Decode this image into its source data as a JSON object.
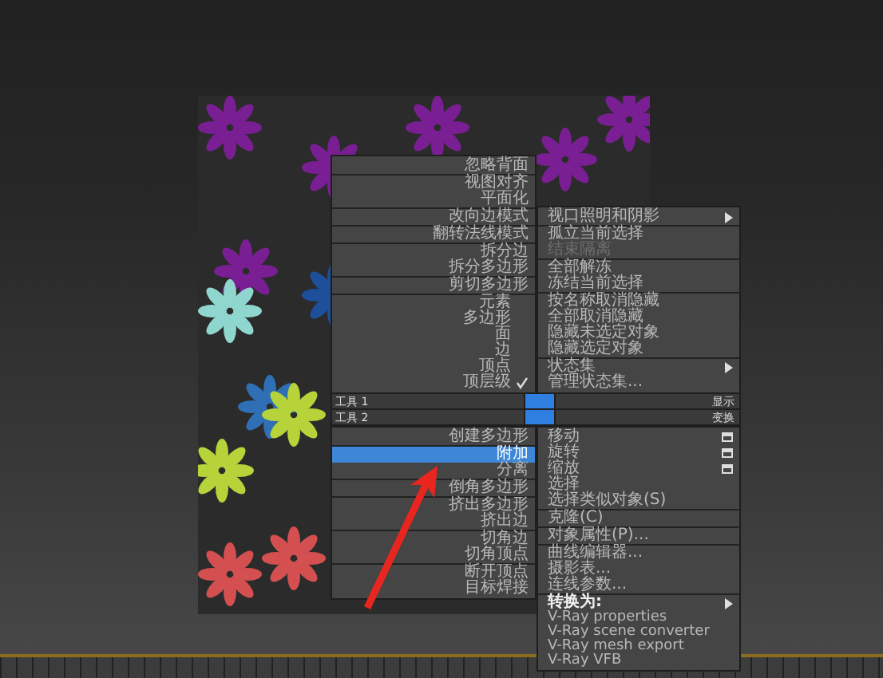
{
  "quad_menu": {
    "top_left": {
      "groups": [
        {
          "items": [
            {
              "label": "忽略背面"
            }
          ]
        },
        {
          "items": [
            {
              "label": "视图对齐"
            },
            {
              "label": "平面化"
            }
          ]
        },
        {
          "items": [
            {
              "label": "改向边模式"
            }
          ]
        },
        {
          "items": [
            {
              "label": "翻转法线模式"
            }
          ]
        },
        {
          "items": [
            {
              "label": "拆分边"
            },
            {
              "label": "拆分多边形"
            }
          ]
        },
        {
          "items": [
            {
              "label": "剪切多边形"
            }
          ]
        },
        {
          "items": [
            {
              "label": "元素",
              "checked": false
            },
            {
              "label": "多边形",
              "checked": false
            },
            {
              "label": "面",
              "checked": false
            },
            {
              "label": "边",
              "checked": false
            },
            {
              "label": "顶点",
              "checked": false
            },
            {
              "label": "顶层级",
              "checked": true
            }
          ]
        }
      ]
    },
    "top_right": {
      "groups": [
        {
          "items": [
            {
              "label": "视口照明和阴影",
              "submenu": true
            }
          ]
        },
        {
          "items": [
            {
              "label": "孤立当前选择",
              "disabled": false
            },
            {
              "label": "结束隔离",
              "disabled": true
            }
          ]
        },
        {
          "items": [
            {
              "label": "全部解冻"
            },
            {
              "label": "冻结当前选择"
            }
          ]
        },
        {
          "items": [
            {
              "label": "按名称取消隐藏"
            },
            {
              "label": "全部取消隐藏"
            },
            {
              "label": "隐藏未选定对象"
            },
            {
              "label": "隐藏选定对象"
            }
          ]
        },
        {
          "items": [
            {
              "label": "状态集",
              "submenu": true
            },
            {
              "label": "管理状态集...",
              "submenu": false
            }
          ]
        }
      ]
    },
    "headers": [
      {
        "label": "工具 1",
        "right": "显示"
      },
      {
        "label": "工具 2",
        "right": "变换"
      }
    ],
    "bottom_left": {
      "groups": [
        {
          "items": [
            {
              "label": "创建多边形",
              "selected": false
            }
          ]
        },
        {
          "items": [
            {
              "label": "附加",
              "selected": true
            },
            {
              "label": "分离",
              "selected": false
            }
          ]
        },
        {
          "items": [
            {
              "label": "倒角多边形",
              "selected": false
            }
          ]
        },
        {
          "items": [
            {
              "label": "挤出多边形",
              "selected": false
            },
            {
              "label": "挤出边",
              "selected": false
            }
          ]
        },
        {
          "items": [
            {
              "label": "切角边",
              "selected": false
            },
            {
              "label": "切角顶点",
              "selected": false
            }
          ]
        },
        {
          "items": [
            {
              "label": "断开顶点",
              "selected": false
            },
            {
              "label": "目标焊接",
              "selected": false
            }
          ]
        }
      ]
    },
    "bottom_right": {
      "groups": [
        {
          "items": [
            {
              "label": "移动",
              "options": true
            },
            {
              "label": "旋转",
              "options": true
            },
            {
              "label": "缩放",
              "options": true
            },
            {
              "label": "选择",
              "options": false
            },
            {
              "label": "选择类似对象(S)",
              "options": false
            }
          ]
        },
        {
          "items": [
            {
              "label": "克隆(C)"
            }
          ]
        },
        {
          "items": [
            {
              "label": "对象属性(P)..."
            }
          ]
        },
        {
          "items": [
            {
              "label": "曲线编辑器..."
            },
            {
              "label": "摄影表..."
            },
            {
              "label": "连线参数..."
            }
          ]
        },
        {
          "header": {
            "label": "转换为:",
            "submenu": true
          },
          "items": [
            {
              "label": "V-Ray properties"
            },
            {
              "label": "V-Ray scene converter"
            },
            {
              "label": "V-Ray mesh export"
            },
            {
              "label": "V-Ray VFB"
            }
          ]
        }
      ]
    }
  }
}
